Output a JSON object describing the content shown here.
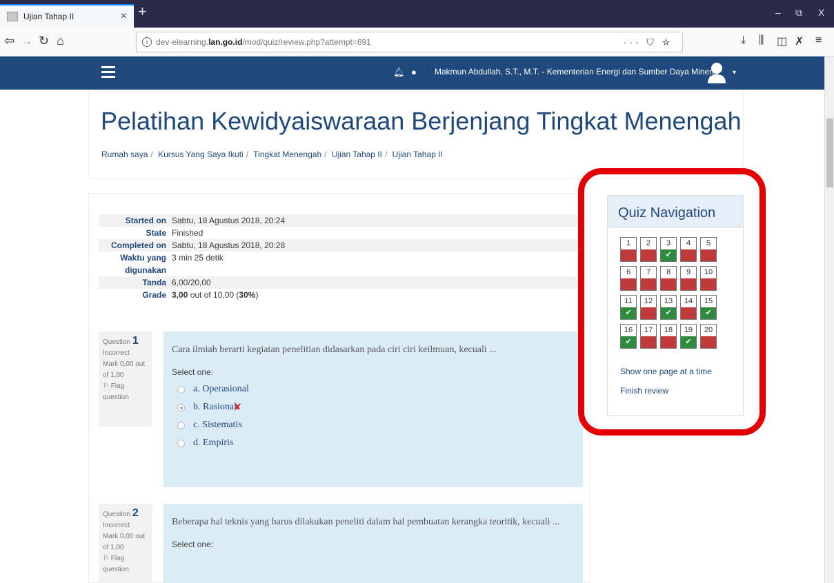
{
  "browser": {
    "tab_title": "Ujian Tahap II",
    "tab_close": "×",
    "new_tab": "+",
    "url_prefix": "dev-elearning.",
    "url_domain": "lan.go.id",
    "url_path": "/mod/quiz/review.php?attempt=691",
    "url_actions": "··· ⛉ ☆",
    "win_min": "–",
    "win_restore": "⧉",
    "win_close": "X"
  },
  "header": {
    "user_name": "Makmun Abdullah, S.T., M.T. - Kementerian Energi dan Sumber Daya Mineral",
    "caret": "▾"
  },
  "page": {
    "title": "Pelatihan Kewidyaiswaraan Berjenjang Tingkat Menengah",
    "breadcrumbs": [
      "Rumah saya",
      "Kursus Yang Saya Ikuti",
      "Tingkat Menengah",
      "Ujian Tahap II",
      "Ujian Tahap II"
    ],
    "separator": "/"
  },
  "summary": [
    {
      "label": "Started on",
      "value": "Sabtu, 18 Agustus 2018, 20:24"
    },
    {
      "label": "State",
      "value": "Finished"
    },
    {
      "label": "Completed on",
      "value": "Sabtu, 18 Agustus 2018, 20:28"
    },
    {
      "label": "Waktu yang digunakan",
      "value": "3 min 25 detik"
    },
    {
      "label": "Tanda",
      "value": "6,00/20,00"
    },
    {
      "label": "Grade",
      "value_bold": "3,00",
      "value_mid": " out of 10,00 (",
      "value_pct": "30%",
      "value_end": ")"
    }
  ],
  "questions": [
    {
      "label": "Question",
      "number": "1",
      "status": "Incorrect",
      "mark": "Mark 0,00 out of 1,00",
      "flag": "Flag question",
      "text": "Cara ilmiah berarti kegiatan penelitian didasarkan pada ciri ciri keilmuan, kecuali ...",
      "select_one": "Select one:",
      "answers": [
        "a. Operasional",
        "b. Rasional",
        "c. Sistematis",
        "d. Empiris"
      ],
      "wrong_mark": "✘"
    },
    {
      "label": "Question",
      "number": "2",
      "status": "Incorrect",
      "mark": "Mark 0,00 out of 1,00",
      "flag": "Flag question",
      "text": "Beberapa hal teknis yang harus dilakukan peneliti dalam hal pembuatan kerangka teoritik, kecuali ...",
      "select_one": "Select one:"
    }
  ],
  "quiz_nav": {
    "title": "Quiz Navigation",
    "rows": [
      [
        {
          "n": "1",
          "s": "incorrect"
        },
        {
          "n": "2",
          "s": "incorrect"
        },
        {
          "n": "3",
          "s": "correct"
        },
        {
          "n": "4",
          "s": "incorrect"
        },
        {
          "n": "5",
          "s": "incorrect"
        }
      ],
      [
        {
          "n": "6",
          "s": "incorrect"
        },
        {
          "n": "7",
          "s": "incorrect"
        },
        {
          "n": "8",
          "s": "incorrect"
        },
        {
          "n": "9",
          "s": "incorrect"
        },
        {
          "n": "10",
          "s": "incorrect"
        }
      ],
      [
        {
          "n": "11",
          "s": "correct"
        },
        {
          "n": "12",
          "s": "incorrect"
        },
        {
          "n": "13",
          "s": "correct"
        },
        {
          "n": "14",
          "s": "incorrect"
        },
        {
          "n": "15",
          "s": "correct"
        }
      ],
      [
        {
          "n": "16",
          "s": "correct"
        },
        {
          "n": "17",
          "s": "incorrect"
        },
        {
          "n": "18",
          "s": "incorrect"
        },
        {
          "n": "19",
          "s": "correct"
        },
        {
          "n": "20",
          "s": "incorrect"
        }
      ]
    ],
    "check": "✔",
    "show_one_page": "Show one page at a time",
    "finish_review": "Finish review",
    "highlight_color": "#e40000"
  }
}
